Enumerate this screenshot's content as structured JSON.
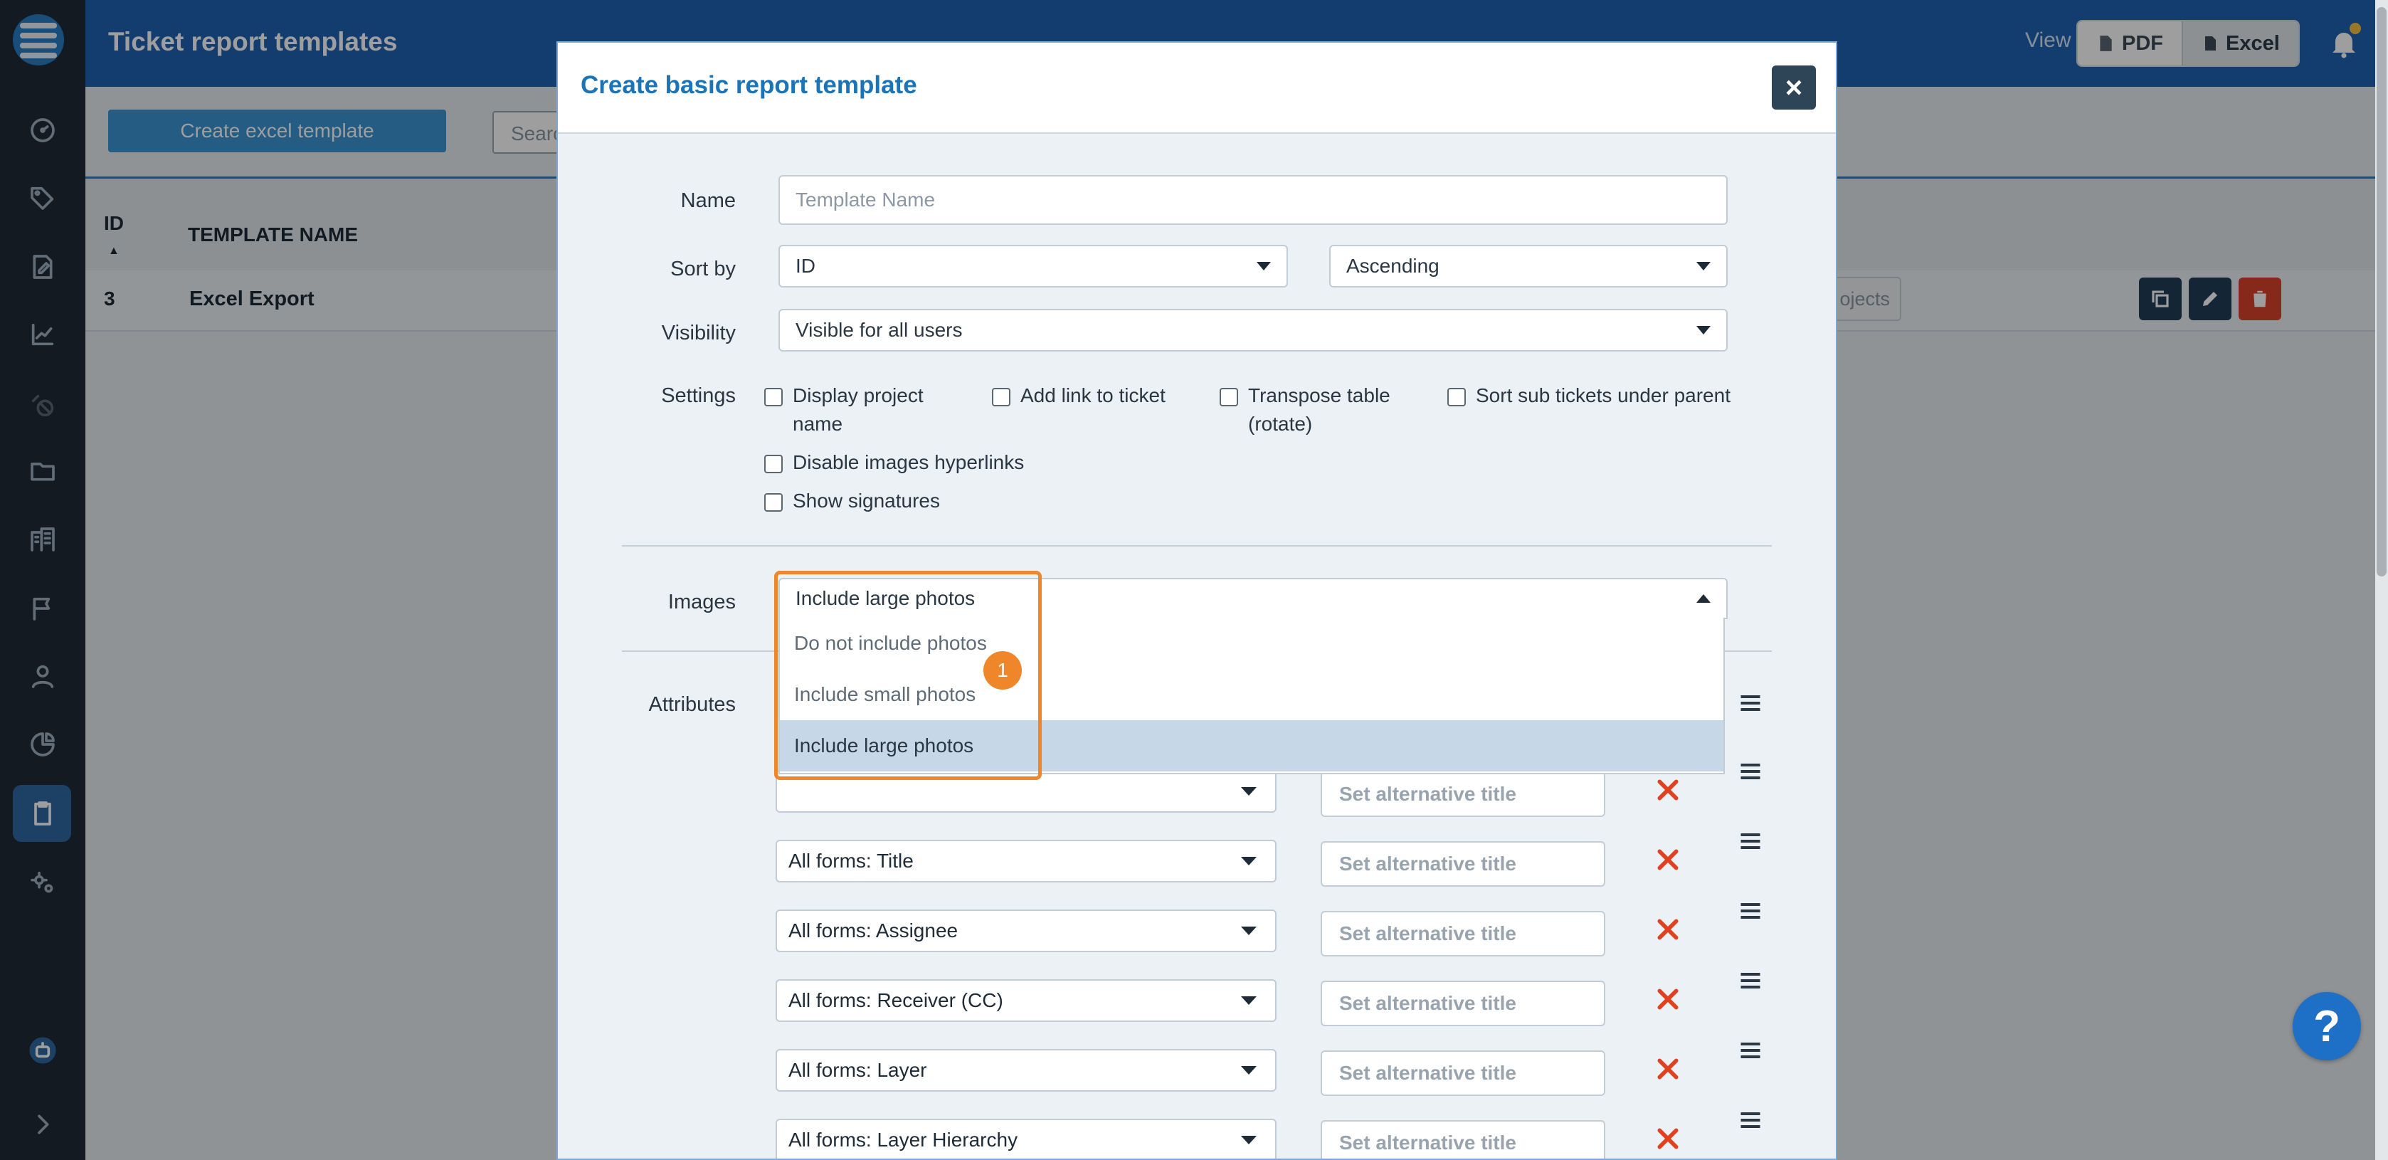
{
  "header": {
    "title": "Ticket report templates",
    "view_label": "View",
    "pdf_label": "PDF",
    "excel_label": "Excel"
  },
  "toolbar": {
    "create_label": "Create excel template",
    "search_placeholder": "Searc"
  },
  "table": {
    "col_id": "ID",
    "sort_indicator": "▲",
    "col_name": "TEMPLATE NAME",
    "rows": [
      {
        "id": "3",
        "name": "Excel Export",
        "projects_label": "ojects"
      }
    ]
  },
  "modal": {
    "title": "Create basic report template",
    "close_label": "×",
    "name_label": "Name",
    "name_placeholder": "Template Name",
    "sort_label": "Sort by",
    "sort_value": "ID",
    "order_value": "Ascending",
    "visibility_label": "Visibility",
    "visibility_value": "Visible for all users",
    "settings_label": "Settings",
    "settings": {
      "display_project_line1": "Display project",
      "display_project_line2": "name",
      "add_link": "Add link to ticket",
      "transpose_line1": "Transpose table",
      "transpose_line2": "(rotate)",
      "sort_sub": "Sort sub tickets under parent",
      "disable_images": "Disable images hyperlinks",
      "show_signatures": "Show signatures"
    },
    "images_label": "Images",
    "images_value": "Include large photos",
    "images_options": [
      "Do not include photos",
      "Include small photos",
      "Include large photos"
    ],
    "attributes_label": "Attributes",
    "alt_placeholder": "Set alternative title",
    "attributes": [
      {
        "field": "All forms: Title"
      },
      {
        "field": "All forms: Assignee"
      },
      {
        "field": "All forms: Receiver (CC)"
      },
      {
        "field": "All forms: Layer"
      },
      {
        "field": "All forms: Layer Hierarchy"
      }
    ]
  },
  "annotation": {
    "step": "1"
  },
  "help_label": "?",
  "colors": {
    "sidebar": "#1f2b38",
    "header": "#1e63b2",
    "accent": "#1a74b7",
    "highlight": "#f0862a",
    "delete": "#d9432c"
  }
}
